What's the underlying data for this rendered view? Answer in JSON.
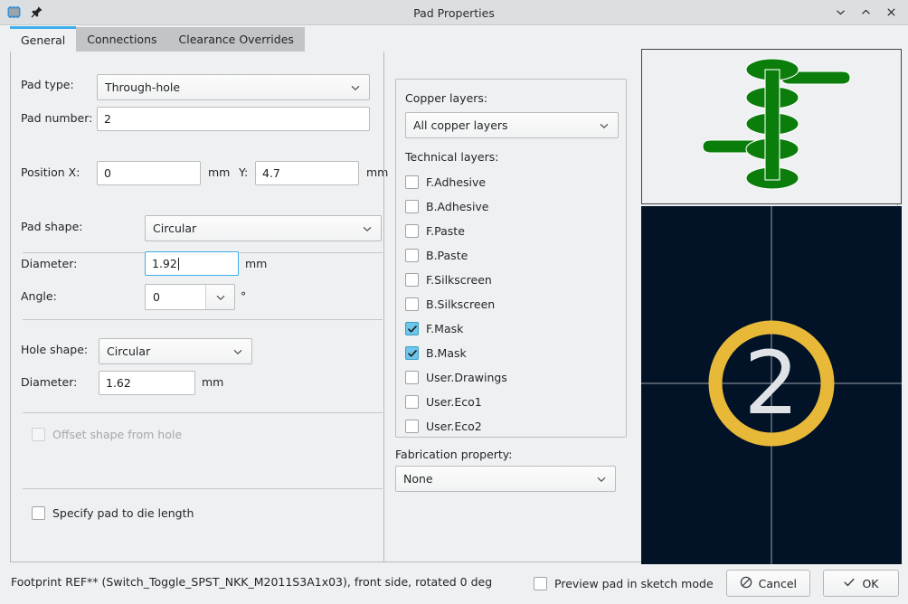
{
  "window": {
    "title": "Pad Properties",
    "app_icon": "chip-icon",
    "pin_icon": "pushpin-icon",
    "controls": [
      {
        "name": "minimize-button",
        "icon": "chevron-down-icon"
      },
      {
        "name": "maximize-button",
        "icon": "chevron-up-icon"
      },
      {
        "name": "close-button",
        "icon": "close-icon"
      }
    ]
  },
  "tabs": [
    {
      "label": "General",
      "active": true
    },
    {
      "label": "Connections",
      "active": false
    },
    {
      "label": "Clearance Overrides",
      "active": false
    }
  ],
  "general": {
    "pad_type": {
      "label": "Pad type:",
      "value": "Through-hole"
    },
    "pad_number": {
      "label": "Pad number:",
      "value": "2"
    },
    "position": {
      "label_x": "Position X:",
      "value_x": "0",
      "unit_x": "mm",
      "label_y": "Y:",
      "value_y": "4.7",
      "unit_y": "mm"
    },
    "pad_shape": {
      "label": "Pad shape:",
      "value": "Circular"
    },
    "pad_diameter": {
      "label": "Diameter:",
      "value": "1.92",
      "unit": "mm",
      "focused": true
    },
    "angle": {
      "label": "Angle:",
      "value": "0",
      "unit": "°"
    },
    "hole_shape": {
      "label": "Hole shape:",
      "value": "Circular"
    },
    "hole_diameter": {
      "label": "Diameter:",
      "value": "1.62",
      "unit": "mm"
    },
    "offset_shape": {
      "label": "Offset shape from hole",
      "checked": false,
      "enabled": false
    },
    "pad_to_die": {
      "label": "Specify pad to die length",
      "checked": false,
      "enabled": true
    }
  },
  "layers": {
    "copper_label": "Copper layers:",
    "copper_value": "All copper layers",
    "technical_label": "Technical layers:",
    "technical": [
      {
        "label": "F.Adhesive",
        "checked": false
      },
      {
        "label": "B.Adhesive",
        "checked": false
      },
      {
        "label": "F.Paste",
        "checked": false
      },
      {
        "label": "B.Paste",
        "checked": false
      },
      {
        "label": "F.Silkscreen",
        "checked": false
      },
      {
        "label": "B.Silkscreen",
        "checked": false
      },
      {
        "label": "F.Mask",
        "checked": true
      },
      {
        "label": "B.Mask",
        "checked": true
      },
      {
        "label": "User.Drawings",
        "checked": false
      },
      {
        "label": "User.Eco1",
        "checked": false
      },
      {
        "label": "User.Eco2",
        "checked": false
      }
    ],
    "fabrication_label": "Fabrication property:",
    "fabrication_value": "None"
  },
  "preview": {
    "stack_color": "#0b7d0b",
    "pad_canvas_bg": "#021227",
    "pad_ring_color": "#e8b939",
    "crosshair_color": "#9aa3ab",
    "pad_label": "2"
  },
  "footer": {
    "status": "Footprint REF** (Switch_Toggle_SPST_NKK_M2011S3A1x03), front side, rotated 0 deg",
    "sketch_mode": {
      "label": "Preview pad in sketch mode",
      "checked": false
    },
    "cancel_label": "Cancel",
    "ok_label": "OK"
  }
}
